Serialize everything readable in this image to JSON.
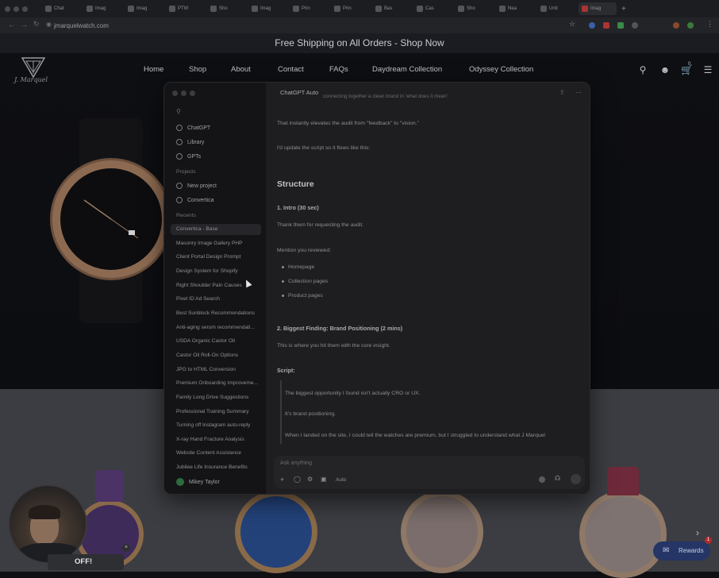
{
  "browser": {
    "tabs": [
      {
        "label": "Chat"
      },
      {
        "label": "Imag"
      },
      {
        "label": "Imag"
      },
      {
        "label": "PTW"
      },
      {
        "label": "Sho"
      },
      {
        "label": "Imag"
      },
      {
        "label": "Prin"
      },
      {
        "label": "Prin"
      },
      {
        "label": "Bas"
      },
      {
        "label": "Cas"
      },
      {
        "label": "Sho"
      },
      {
        "label": "Nea"
      },
      {
        "label": "Untl"
      },
      {
        "label": "Imag"
      }
    ],
    "url": "jmarquelwatch.com"
  },
  "site": {
    "shipping_banner": "Free Shipping on All Orders - Shop Now",
    "brand": "J. Marquel",
    "nav": {
      "home": "Home",
      "shop": "Shop",
      "about": "About",
      "contact": "Contact",
      "faqs": "FAQs",
      "daydream": "Daydream Collection",
      "odyssey": "Odyssey Collection"
    },
    "cart_count": "0",
    "promo_suffix": "OFF!",
    "rewards_label": "Rewards",
    "rewards_badge": "1"
  },
  "chatgpt": {
    "sidebar": {
      "nav": [
        {
          "label": "ChatGPT",
          "icon": "chatgpt-icon"
        },
        {
          "label": "Library",
          "icon": "library-icon"
        },
        {
          "label": "GPTs",
          "icon": "gpts-icon"
        }
      ],
      "projects_heading": "Projects",
      "projects": [
        {
          "label": "New project"
        },
        {
          "label": "Convertica"
        }
      ],
      "recents_heading": "Recents",
      "recents": [
        "Convertica - Base",
        "Masonry Image Gallery PHP",
        "Client Portal Design Prompt",
        "Design System for Shopify",
        "Right Shoulder Pain Causes",
        "Pixel ID Ad Search",
        "Best Sunblock Recommendations",
        "Anti-aging serum recommendati...",
        "USDA Organic Castor Oil",
        "Castor Oil Roll-On Options",
        "JPG to HTML Conversion",
        "Premium Onboarding Improveme...",
        "Family Long Drive Suggestions",
        "Professional Training Summary",
        "Turning off Instagram auto-reply",
        "X-ray Hand Fracture Analysis",
        "Website Content Assistance",
        "Jubilee Life Insurance Benefits"
      ],
      "user": "Mikey Taylor"
    },
    "main": {
      "title": "ChatGPT Auto",
      "lines": {
        "top_partial": "connecting together a clean brand in 'what does it mean'",
        "p1": "That instantly elevates the audit from \"feedback\" to \"vision.\"",
        "p2": "I'd update the script so it flows like this:",
        "h_structure": "Structure",
        "h_intro": "1. Intro (30 sec)",
        "intro_text": "Thank them for requesting the audit.",
        "mention": "Mention you reviewed:",
        "bullets": [
          "Homepage",
          "Collection pages",
          "Product pages"
        ],
        "h_finding": "2. Biggest Finding: Brand Positioning (2 mins)",
        "finding_text": "This is where you hit them with the core insight.",
        "script_label": "Script:",
        "quote1": "The biggest opportunity I found isn't actually CRO or UX.",
        "quote2": "It's brand positioning.",
        "quote3": "When I landed on the site, I could tell the watches are premium, but I struggled to understand what J Marquel"
      },
      "composer_placeholder": "Ask anything",
      "composer_mode": "Auto"
    }
  }
}
